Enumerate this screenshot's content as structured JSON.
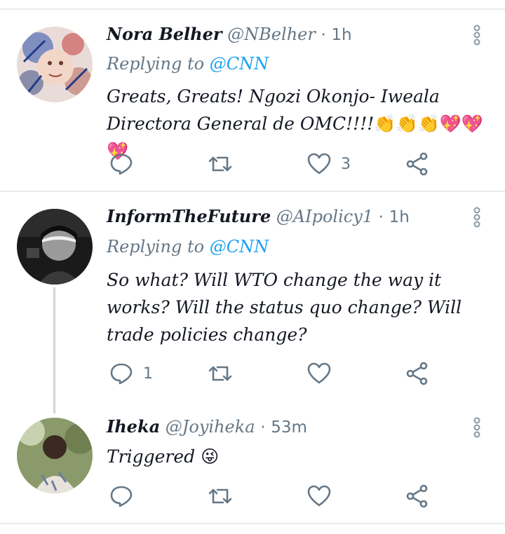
{
  "tweets": [
    {
      "name": "Nora Belher",
      "handle": "@NBelher",
      "time": "1h",
      "replying_prefix": "Replying to",
      "replying_mention": "@CNN",
      "text": "Greats, Greats! Ngozi Okonjo- Iweala Directora General de OMC!!!!",
      "emojis": "👏👏👏💖💖💖",
      "reply_count": "",
      "retweet_count": "",
      "like_count": "3"
    },
    {
      "name": "InformTheFuture",
      "handle": "@AIpolicy1",
      "time": "1h",
      "replying_prefix": "Replying to",
      "replying_mention": "@CNN",
      "text": "So what? Will WTO change the way it works? Will the status quo change? Will trade policies change?",
      "reply_count": "1",
      "retweet_count": "",
      "like_count": ""
    },
    {
      "name": "Iheka",
      "handle": "@Joyiheka",
      "time": "53m",
      "text": "Triggered",
      "emojis": "😜",
      "reply_count": "",
      "retweet_count": "",
      "like_count": ""
    }
  ],
  "separator": "·",
  "icons": {
    "reply": "reply-icon",
    "retweet": "retweet-icon",
    "like": "heart-icon",
    "share": "share-icon",
    "more": "more-icon"
  },
  "colors": {
    "mention": "#1da1f2",
    "muted": "#657786",
    "divider": "#e6ecf0"
  }
}
